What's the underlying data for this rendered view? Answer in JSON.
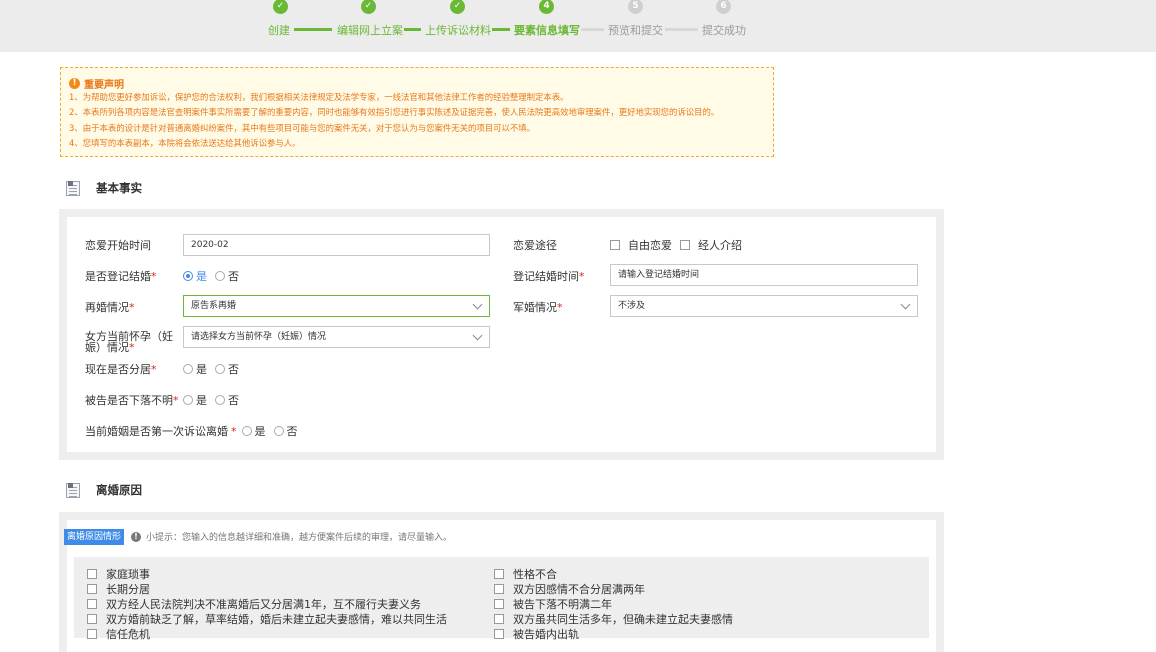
{
  "stepper": {
    "steps": [
      {
        "num": "✓",
        "label": "创建"
      },
      {
        "num": "✓",
        "label": "编辑网上立案"
      },
      {
        "num": "✓",
        "label": "上传诉讼材料"
      },
      {
        "num": "4",
        "label": "要素信息填写"
      },
      {
        "num": "5",
        "label": "预览和提交"
      },
      {
        "num": "6",
        "label": "提交成功"
      }
    ]
  },
  "notice": {
    "title": "重要声明",
    "lines": [
      "1、为帮助您更好参加诉讼，保护您的合法权利，我们根据相关法律规定及法学专家，一线法官和其他法律工作者的经验整理制定本表。",
      "2、本表所列各项内容是法官查明案件事实所需要了解的重要内容，同时也能够有效指引您进行事实陈述及证据完善，使人民法院更高效地审理案件，更好地实现您的诉讼目的。",
      "3、由于本表的设计是针对普通离婚纠纷案件，其中有些项目可能与您的案件无关，对于您认为与您案件无关的项目可以不填。",
      "4、您填写的本表副本，本院将会依法送达给其他诉讼参与人。"
    ]
  },
  "basic": {
    "title": "基本事实",
    "love_start_label": "恋爱开始时间",
    "love_start_value": "2020-02",
    "love_way_label": "恋爱途径",
    "love_way_opt1": "自由恋爱",
    "love_way_opt2": "经人介绍",
    "registered_label": "是否登记结婚",
    "yes": "是",
    "no": "否",
    "reg_time_label": "登记结婚时间",
    "reg_time_placeholder": "请输入登记结婚时间",
    "remarry_label": "再婚情况",
    "remarry_value": "原告系再婚",
    "military_label": "军婚情况",
    "military_value": "不涉及",
    "pregnant_label": "女方当前怀孕（妊娠）情况",
    "pregnant_placeholder": "请选择女方当前怀孕（妊娠）情况",
    "separated_label": "现在是否分居",
    "missing_label": "被告是否下落不明",
    "first_divorce_label": "当前婚姻是否第一次诉讼离婚",
    "req_mark": "*"
  },
  "reason": {
    "title": "离婚原因",
    "tag": "离婚原因情形",
    "tip": "小提示：您输入的信息越详细和准确，越方便案件后续的审理，请尽量输入。",
    "left_items": [
      "家庭琐事",
      "长期分居",
      "双方经人民法院判决不准离婚后又分居满1年，互不履行夫妻义务",
      "双方婚前缺乏了解，草率结婚，婚后未建立起夫妻感情，难以共同生活",
      "信任危机"
    ],
    "right_items": [
      "性格不合",
      "双方因感情不合分居满两年",
      "被告下落不明满二年",
      "双方虽共同生活多年，但确未建立起夫妻感情",
      "被告婚内出轨"
    ]
  },
  "colors": {
    "accent_green": "#6ab934",
    "accent_blue": "#3e8be8",
    "warning_orange": "#e8781a",
    "required_red": "#d9241c"
  }
}
